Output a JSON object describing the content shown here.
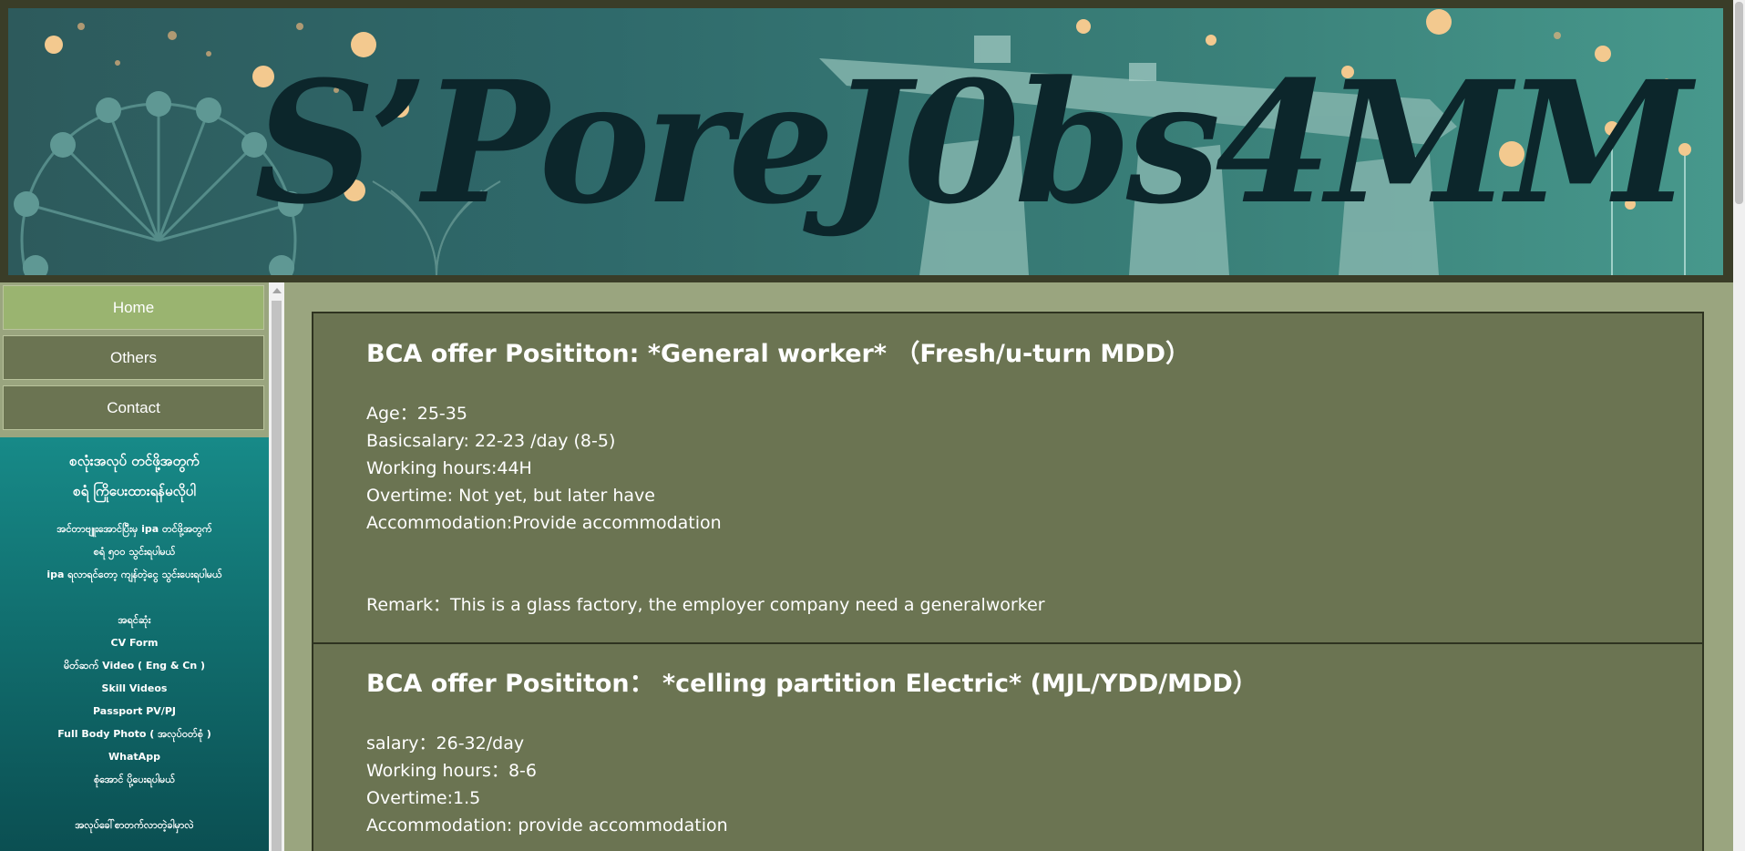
{
  "header": {
    "logo_text": "S’PoreJ0bs4MM"
  },
  "nav": {
    "items": [
      {
        "label": "Home",
        "active": true
      },
      {
        "label": "Others",
        "active": false
      },
      {
        "label": "Contact",
        "active": false
      }
    ]
  },
  "sidebar_info": {
    "heading_lines": [
      "စလုံးအလုပ် တင်ဖို့အတွက်",
      "စရံ ကြိုပေးထားရန်မလိုပါ"
    ],
    "intro_lines": [
      "အင်တာဗျူးအောင်ပြီးမှ ipa တင်ဖို့အတွက်",
      "စရံ ၅၀၀ သွင်းရပါမယ်",
      "ipa ရလာရင်တော့ ကျန်တဲ့ငွေ သွင်းပေးရပါမယ်"
    ],
    "requirements_title": "အရင်ဆုံး",
    "requirements": [
      "CV Form",
      "မိတ်ဆက် Video ( Eng & Cn )",
      "Skill Videos",
      "Passport PV/PJ",
      "Full Body Photo ( အလုပ်ဝတ်စုံ )",
      "WhatApp",
      "စုံအောင် ပို့ပေးရပါမယ်"
    ],
    "footer_line": "အလုပ်ခေါ်စာတက်လာတဲ့ခါမှာလဲ"
  },
  "posts": [
    {
      "title": "BCA offer Posititon: *General worker*  （Fresh/u-turn MDD）",
      "details": [
        "Age：25-35",
        "Basicsalary: 22-23 /day (8-5)",
        "Working hours:44H",
        "Overtime: Not yet, but later have",
        "Accommodation:Provide accommodation"
      ],
      "remark": "Remark：This is a glass factory, the employer company need a generalworker"
    },
    {
      "title": "BCA offer Posititon： *celling partition Electric* (MJL/YDD/MDD）",
      "details": [
        "salary：26-32/day",
        "Working hours：8-6",
        "Overtime:1.5",
        "Accommodation: provide accommodation"
      ]
    }
  ],
  "colors": {
    "page_bg": "#9aa57f",
    "nav_bg": "#6b7452",
    "nav_active": "#9ab470",
    "panel_teal": "#178a88",
    "content_bg": "#6b7452",
    "logo_text": "#0c262b"
  }
}
